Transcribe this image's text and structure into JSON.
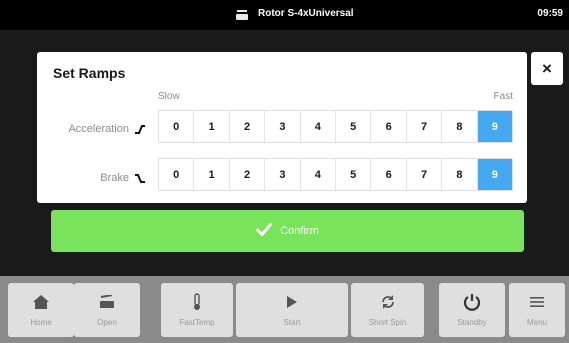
{
  "status_bar": {
    "rotor_icon": "rotor-icon",
    "rotor_name": "Rotor S-4xUniversal",
    "clock": "09:59"
  },
  "dialog": {
    "title": "Set Ramps",
    "slow_label": "Slow",
    "fast_label": "Fast",
    "rows": [
      {
        "label": "Acceleration",
        "icon": "ramp-up-icon",
        "values": [
          "0",
          "1",
          "2",
          "3",
          "4",
          "5",
          "6",
          "7",
          "8",
          "9"
        ],
        "selected": "9"
      },
      {
        "label": "Brake",
        "icon": "ramp-down-icon",
        "values": [
          "0",
          "1",
          "2",
          "3",
          "4",
          "5",
          "6",
          "7",
          "8",
          "9"
        ],
        "selected": "9"
      }
    ],
    "accent_color": "#45a9f0",
    "close_label": "×"
  },
  "confirm": {
    "label": "Confirm",
    "icon": "checkmark-icon",
    "color": "#78e35b"
  },
  "nav": [
    {
      "label": "Home",
      "icon": "home-icon"
    },
    {
      "label": "Open",
      "icon": "open-lid-icon"
    },
    {
      "label": "FastTemp",
      "icon": "thermometer-icon"
    },
    {
      "label": "Start",
      "icon": "play-icon"
    },
    {
      "label": "Short Spin",
      "icon": "short-spin-icon"
    },
    {
      "label": "Standby",
      "icon": "power-icon"
    },
    {
      "label": "Menu",
      "icon": "menu-icon"
    }
  ]
}
